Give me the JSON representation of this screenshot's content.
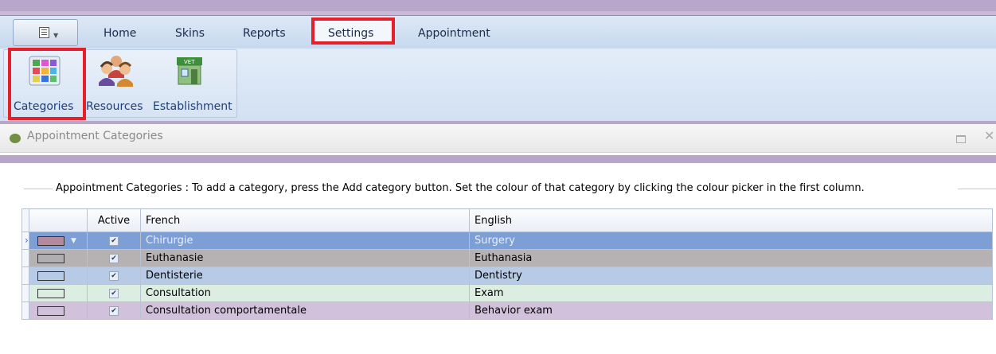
{
  "tabs": [
    {
      "label": "Home"
    },
    {
      "label": "Skins"
    },
    {
      "label": "Reports"
    },
    {
      "label": "Settings"
    },
    {
      "label": "Appointment"
    }
  ],
  "ribbon": {
    "buttons": [
      {
        "label": "Categories",
        "icon": "categories-icon"
      },
      {
        "label": "Resources",
        "icon": "resources-icon"
      },
      {
        "label": "Establishment",
        "icon": "establishment-icon"
      }
    ]
  },
  "panel": {
    "title": "Appointment Categories"
  },
  "legend": "Appointment Categories : To add a category, press the Add category button. Set the colour of that category by clicking the colour picker in the first column.",
  "grid": {
    "headers": {
      "active": "Active",
      "french": "French",
      "english": "English"
    },
    "rows": [
      {
        "swatch": "#b48a9c",
        "active": true,
        "french": "Chirurgie",
        "english": "Surgery",
        "bg": "#7d9fd6"
      },
      {
        "swatch": "#b1aeb2",
        "active": true,
        "french": "Euthanasie",
        "english": "Euthanasia",
        "bg": "#b6b2b3"
      },
      {
        "swatch": "#b7cbe6",
        "active": true,
        "french": "Dentisterie",
        "english": "Dentistry",
        "bg": "#b8cbe6"
      },
      {
        "swatch": "#dcede1",
        "active": true,
        "french": "Consultation",
        "english": "Exam",
        "bg": "#dcede1"
      },
      {
        "swatch": "#d1c0d9",
        "active": true,
        "french": "Consultation comportamentale",
        "english": "Behavior exam",
        "bg": "#d2c1da"
      }
    ]
  },
  "colors": {
    "highlight": "#e5202a",
    "selected_row": "#7d9fd6"
  }
}
